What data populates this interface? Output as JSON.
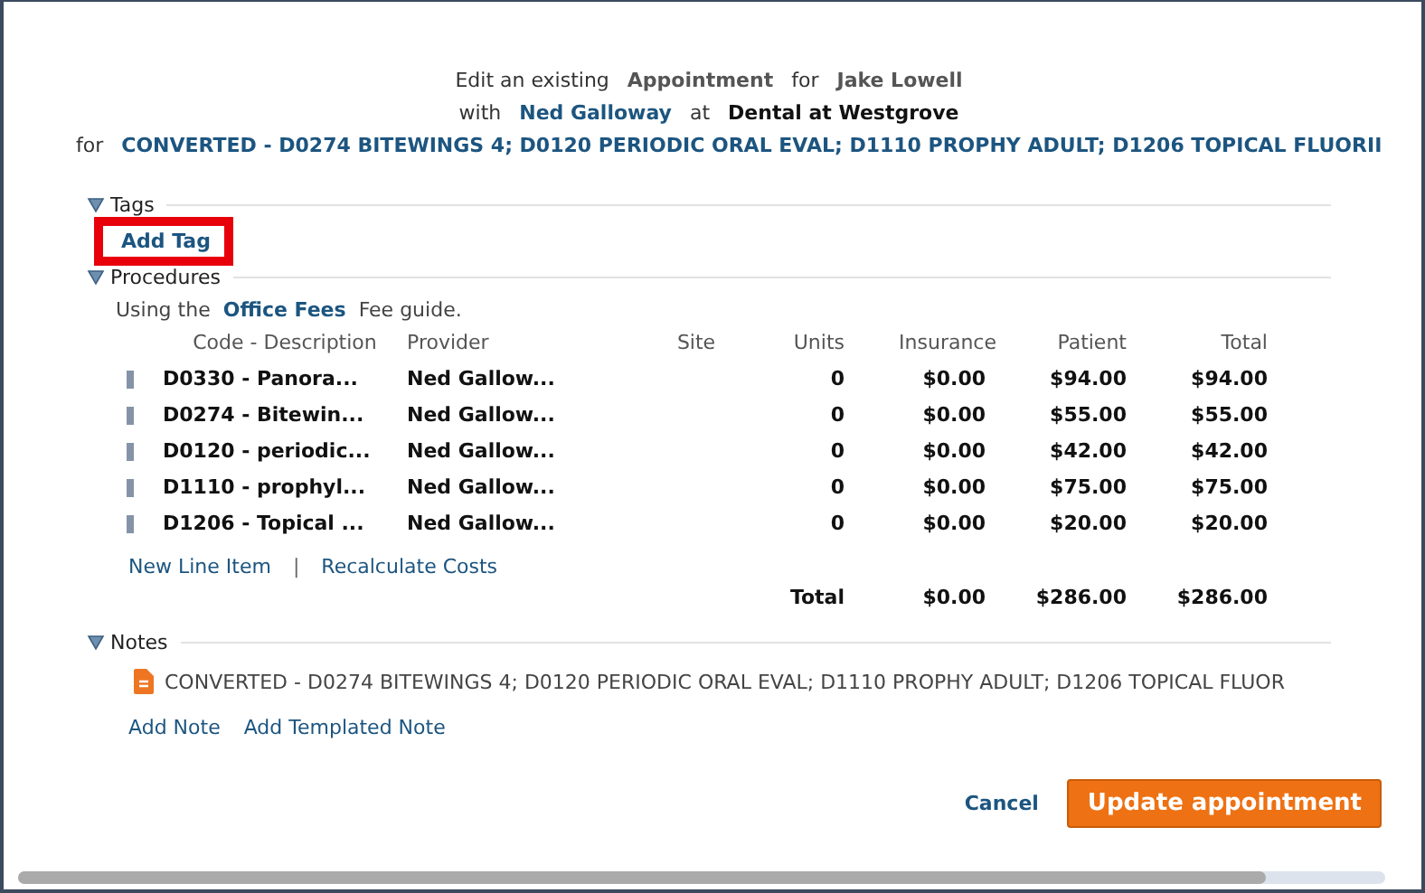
{
  "header": {
    "line1": [
      {
        "text": "Edit an existing",
        "kind": "plain"
      },
      {
        "text": "Appointment",
        "kind": "strong"
      },
      {
        "text": "for",
        "kind": "plain"
      },
      {
        "text": "Jake Lowell",
        "kind": "strong"
      }
    ],
    "line2": [
      {
        "text": "with",
        "kind": "plain"
      },
      {
        "text": "Ned Galloway",
        "kind": "link"
      },
      {
        "text": "at",
        "kind": "plain"
      },
      {
        "text": "Dental at Westgrove",
        "kind": "dark"
      }
    ],
    "line3": [
      {
        "text": "for",
        "kind": "plain"
      },
      {
        "text": "CONVERTED - D0274 BITEWINGS 4; D0120 PERIODIC ORAL EVAL; D1110 PROPHY ADULT; D1206 TOPICAL FLUORII",
        "kind": "link"
      }
    ]
  },
  "tags": {
    "title": "Tags",
    "expanded": true,
    "add_label": "Add Tag",
    "highlighted": true
  },
  "procedures": {
    "title": "Procedures",
    "expanded": true,
    "fee_prefix": "Using the",
    "fee_guide": "Office Fees",
    "fee_suffix": "Fee guide.",
    "columns": [
      "Code - Description",
      "Provider",
      "Site",
      "Units",
      "Insurance",
      "Patient",
      "Total"
    ],
    "rows": [
      {
        "code": "D0330 - Panora...",
        "provider": "Ned Gallow...",
        "units": "0",
        "insurance": "$0.00",
        "patient": "$94.00",
        "total": "$94.00"
      },
      {
        "code": "D0274 - Bitewin...",
        "provider": "Ned Gallow...",
        "units": "0",
        "insurance": "$0.00",
        "patient": "$55.00",
        "total": "$55.00"
      },
      {
        "code": "D0120 - periodic...",
        "provider": "Ned Gallow...",
        "units": "0",
        "insurance": "$0.00",
        "patient": "$42.00",
        "total": "$42.00"
      },
      {
        "code": "D1110 - prophyl...",
        "provider": "Ned Gallow...",
        "units": "0",
        "insurance": "$0.00",
        "patient": "$75.00",
        "total": "$75.00"
      },
      {
        "code": "D1206 - Topical ...",
        "provider": "Ned Gallow...",
        "units": "0",
        "insurance": "$0.00",
        "patient": "$20.00",
        "total": "$20.00"
      }
    ],
    "actions": [
      "New Line Item",
      "Recalculate Costs"
    ],
    "separator": "|",
    "totals": {
      "label": "Total",
      "insurance": "$0.00",
      "patient": "$286.00",
      "total": "$286.00"
    }
  },
  "notes": {
    "title": "Notes",
    "expanded": true,
    "items": [
      "CONVERTED - D0274 BITEWINGS 4; D0120 PERIODIC ORAL EVAL; D1110 PROPHY ADULT; D1206 TOPICAL FLUOR"
    ],
    "actions": [
      "Add Note",
      "Add Templated Note"
    ]
  },
  "buttons": {
    "cancel": "Cancel",
    "submit": "Update appointment"
  }
}
